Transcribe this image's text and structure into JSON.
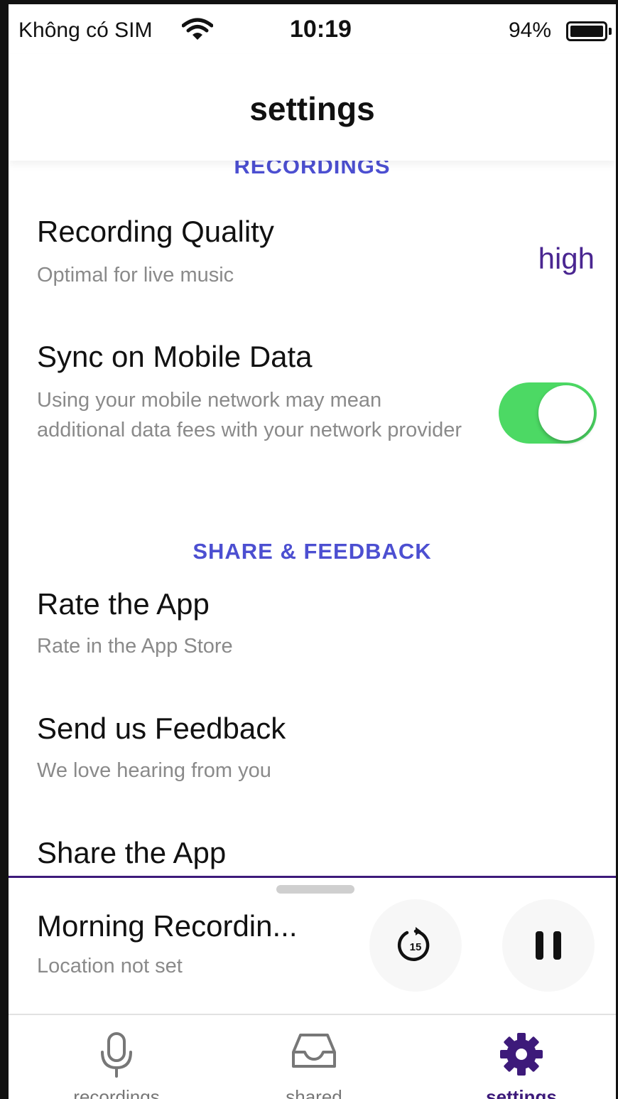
{
  "status_bar": {
    "carrier": "Không có SIM",
    "time": "10:19",
    "battery": "94%",
    "icons": [
      "wifi-icon",
      "battery-icon"
    ]
  },
  "header": {
    "title": "settings"
  },
  "sections": [
    {
      "heading": "RECORDINGS",
      "rows": [
        {
          "title": "Recording Quality",
          "subtitle": "Optimal for live music",
          "value": "high"
        },
        {
          "title": "Sync on Mobile Data",
          "subtitle": "Using your mobile network may mean additional data fees with your network provider",
          "toggle": true
        }
      ]
    },
    {
      "heading": "SHARE & FEEDBACK",
      "rows": [
        {
          "title": "Rate the App",
          "subtitle": "Rate in the App Store"
        },
        {
          "title": "Send us Feedback",
          "subtitle": "We love hearing from you"
        },
        {
          "title": "Share the App"
        }
      ]
    }
  ],
  "player": {
    "title": "Morning Recordin...",
    "subtitle": "Location not set",
    "skip_back_seconds": "15",
    "icons": [
      "replay-15-icon",
      "pause-icon"
    ]
  },
  "tabs": [
    {
      "label": "recordings",
      "icon": "microphone-icon"
    },
    {
      "label": "shared",
      "icon": "inbox-icon"
    },
    {
      "label": "settings",
      "icon": "gear-icon",
      "active": true
    }
  ],
  "colors": {
    "accent": "#4a2691",
    "section_heading": "#4c4fd1",
    "toggle_on": "#4cd964",
    "player_border": "#3d1a7a"
  }
}
